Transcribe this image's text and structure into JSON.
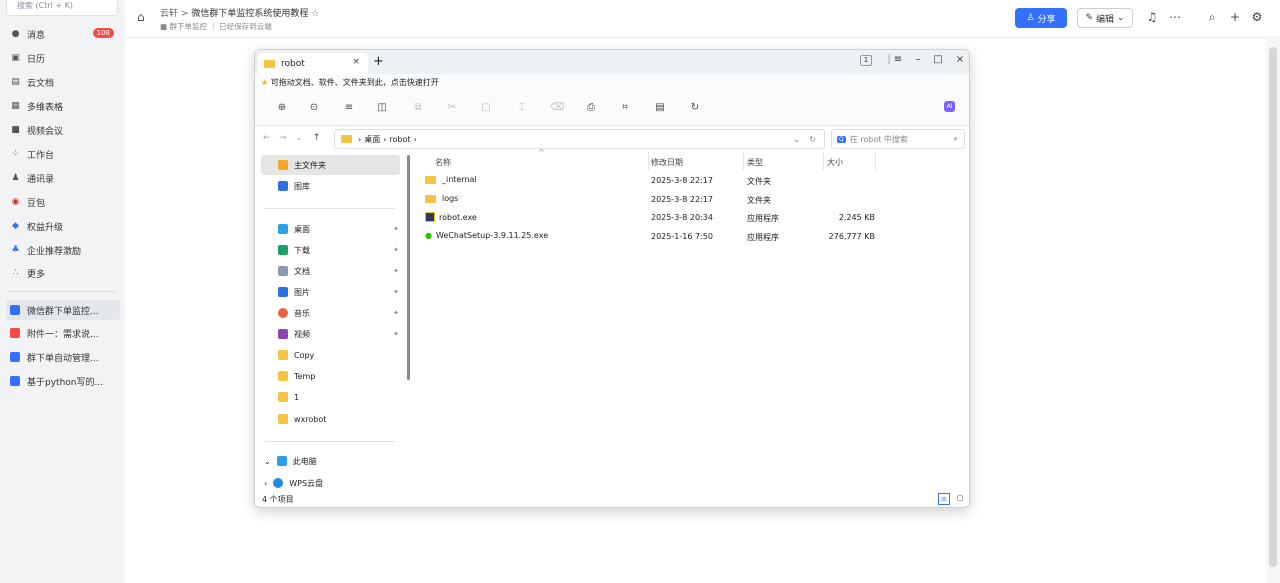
{
  "sidebar": {
    "search_placeholder": "搜索 (Ctrl + K)",
    "items": [
      {
        "label": "消息",
        "icon": "chat-bubble-icon",
        "badge": "108"
      },
      {
        "label": "日历",
        "icon": "calendar-icon"
      },
      {
        "label": "云文档",
        "icon": "cloud-doc-icon"
      },
      {
        "label": "多维表格",
        "icon": "table-grid-icon"
      },
      {
        "label": "视频会议",
        "icon": "video-camera-icon"
      },
      {
        "label": "工作台",
        "icon": "apps-grid-icon"
      },
      {
        "label": "通讯录",
        "icon": "contacts-icon"
      },
      {
        "label": "豆包",
        "icon": "doubao-icon"
      },
      {
        "label": "权益升级",
        "icon": "diamond-icon"
      },
      {
        "label": "企业推荐激励",
        "icon": "gift-people-icon"
      },
      {
        "label": "更多",
        "icon": "more-dots-icon"
      }
    ],
    "docs": [
      {
        "label": "微信群下单监控...",
        "color": "#3370ff"
      },
      {
        "label": "附件一：需求说...",
        "color": "#f54a45"
      },
      {
        "label": "群下单自动管理...",
        "color": "#3370ff"
      },
      {
        "label": "基于python写的...",
        "color": "#3370ff"
      }
    ]
  },
  "header": {
    "crumb_root": "云轩",
    "crumb_sep": ">",
    "doc_title": "微信群下单监控系统使用教程",
    "folder": "群下单监控",
    "save_status": "已经保存到云端",
    "share_label": "分享",
    "edit_label": "编辑"
  },
  "explorer": {
    "tab_title": "robot",
    "tab_close": "×",
    "tab_add": "+",
    "badge_num": "1",
    "tip": "可拖动文档、软件、文件夹到此，点击快速打开",
    "path_desktop": "桌面",
    "path_robot": "robot",
    "search_placeholder": "在 robot 中搜索",
    "nav": {
      "home": "主文件夹",
      "gallery": "图库",
      "pinned": [
        "桌面",
        "下载",
        "文档",
        "图片",
        "音乐",
        "视频"
      ],
      "folders": [
        "Copy",
        "Temp",
        "1",
        "wxrobot"
      ],
      "this_pc": "此电脑",
      "wps": "WPS云盘"
    },
    "columns": {
      "name": "名称",
      "date": "修改日期",
      "type": "类型",
      "size": "大小"
    },
    "files": [
      {
        "name": "_internal",
        "date": "2025-3-8 22:17",
        "type": "文件夹",
        "size": "",
        "kind": "folder"
      },
      {
        "name": "logs",
        "date": "2025-3-8 22:17",
        "type": "文件夹",
        "size": "",
        "kind": "folder"
      },
      {
        "name": "robot.exe",
        "date": "2025-3-8 20:34",
        "type": "应用程序",
        "size": "2,245 KB",
        "kind": "exe"
      },
      {
        "name": "WeChatSetup-3.9.11.25.exe",
        "date": "2025-1-16 7:50",
        "type": "应用程序",
        "size": "276,777 KB",
        "kind": "wechat"
      }
    ],
    "status": "4 个项目"
  }
}
